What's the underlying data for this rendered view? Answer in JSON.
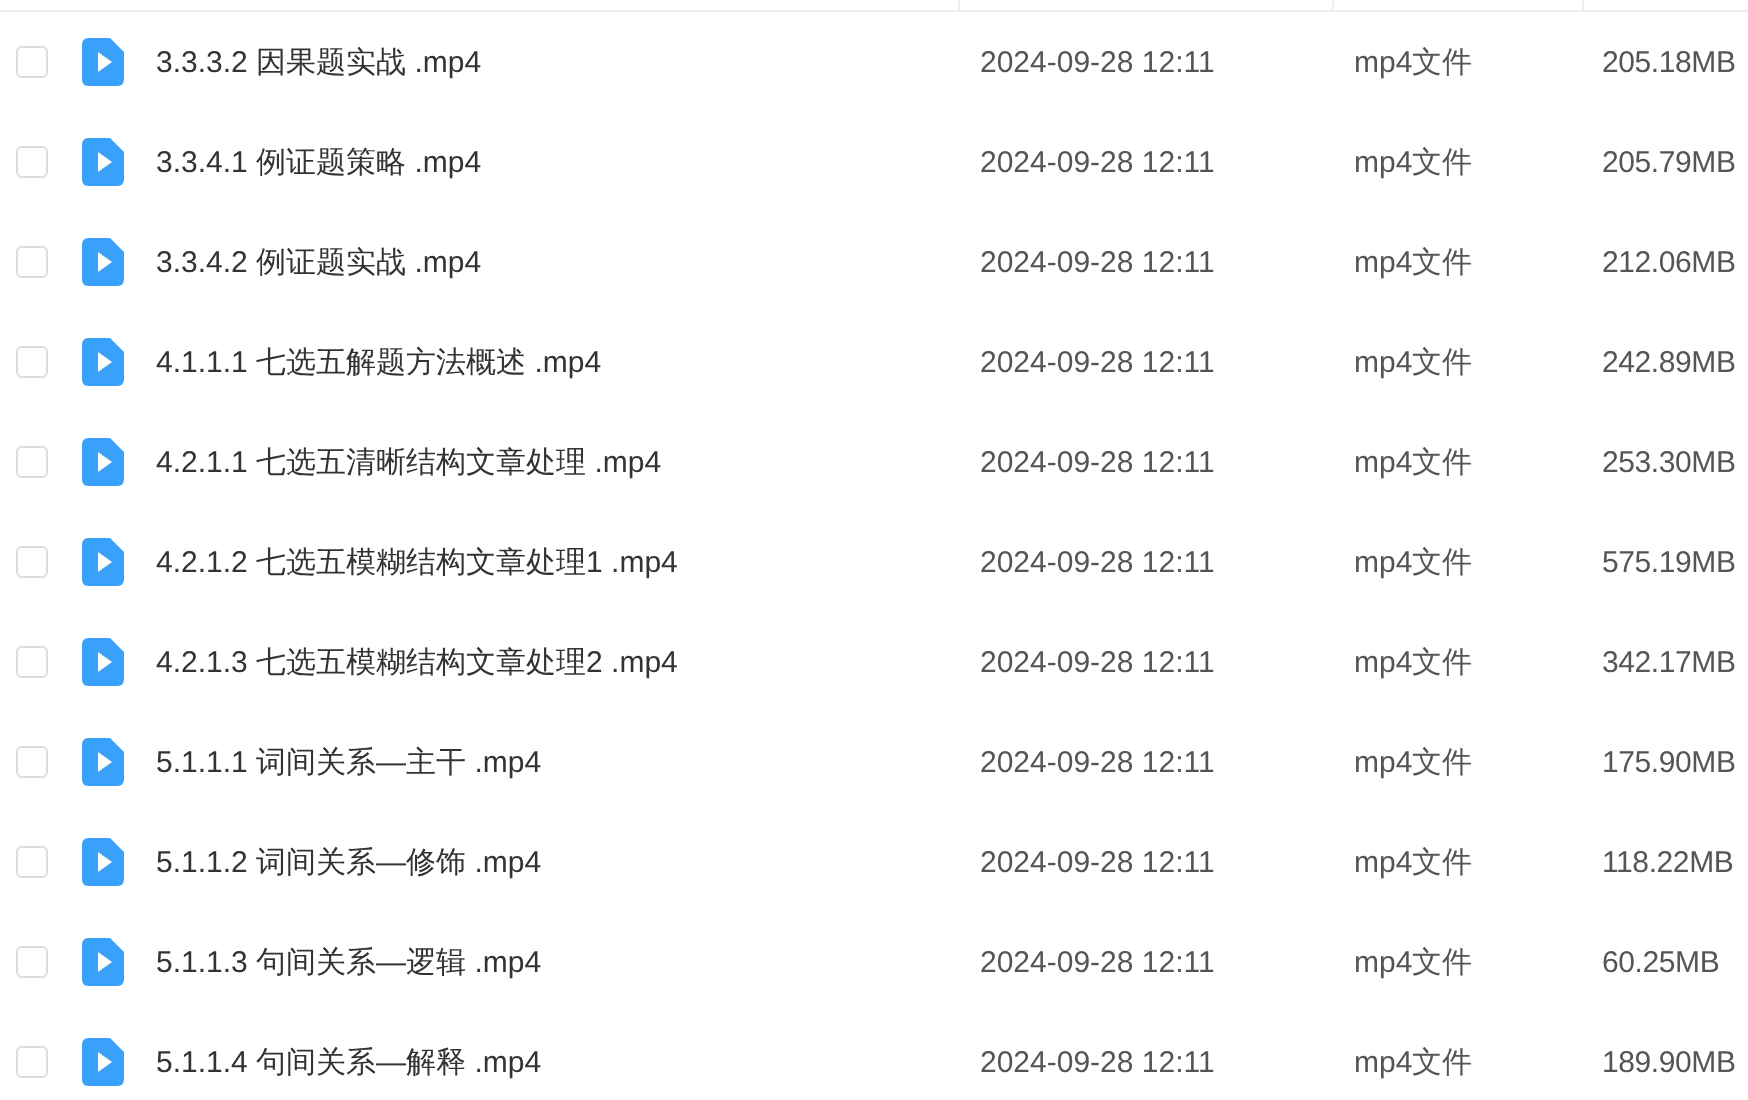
{
  "files": [
    {
      "name": "3.3.3.2 因果题实战 .mp4",
      "modified": "2024-09-28 12:11",
      "type": "mp4文件",
      "size": "205.18MB",
      "checked": false
    },
    {
      "name": "3.3.4.1 例证题策略 .mp4",
      "modified": "2024-09-28 12:11",
      "type": "mp4文件",
      "size": "205.79MB",
      "checked": false
    },
    {
      "name": "3.3.4.2 例证题实战 .mp4",
      "modified": "2024-09-28 12:11",
      "type": "mp4文件",
      "size": "212.06MB",
      "checked": false
    },
    {
      "name": "4.1.1.1 七选五解题方法概述 .mp4",
      "modified": "2024-09-28 12:11",
      "type": "mp4文件",
      "size": "242.89MB",
      "checked": false
    },
    {
      "name": "4.2.1.1 七选五清晰结构文章处理 .mp4",
      "modified": "2024-09-28 12:11",
      "type": "mp4文件",
      "size": "253.30MB",
      "checked": false
    },
    {
      "name": "4.2.1.2 七选五模糊结构文章处理1 .mp4",
      "modified": "2024-09-28 12:11",
      "type": "mp4文件",
      "size": "575.19MB",
      "checked": false
    },
    {
      "name": "4.2.1.3 七选五模糊结构文章处理2 .mp4",
      "modified": "2024-09-28 12:11",
      "type": "mp4文件",
      "size": "342.17MB",
      "checked": false
    },
    {
      "name": "5.1.1.1 词间关系—主干 .mp4",
      "modified": "2024-09-28 12:11",
      "type": "mp4文件",
      "size": "175.90MB",
      "checked": false
    },
    {
      "name": "5.1.1.2 词间关系—修饰 .mp4",
      "modified": "2024-09-28 12:11",
      "type": "mp4文件",
      "size": "118.22MB",
      "checked": false
    },
    {
      "name": "5.1.1.3 句间关系—逻辑 .mp4",
      "modified": "2024-09-28 12:11",
      "type": "mp4文件",
      "size": "60.25MB",
      "checked": false
    },
    {
      "name": "5.1.1.4 句间关系—解释 .mp4",
      "modified": "2024-09-28 12:11",
      "type": "mp4文件",
      "size": "189.90MB",
      "checked": false
    }
  ]
}
